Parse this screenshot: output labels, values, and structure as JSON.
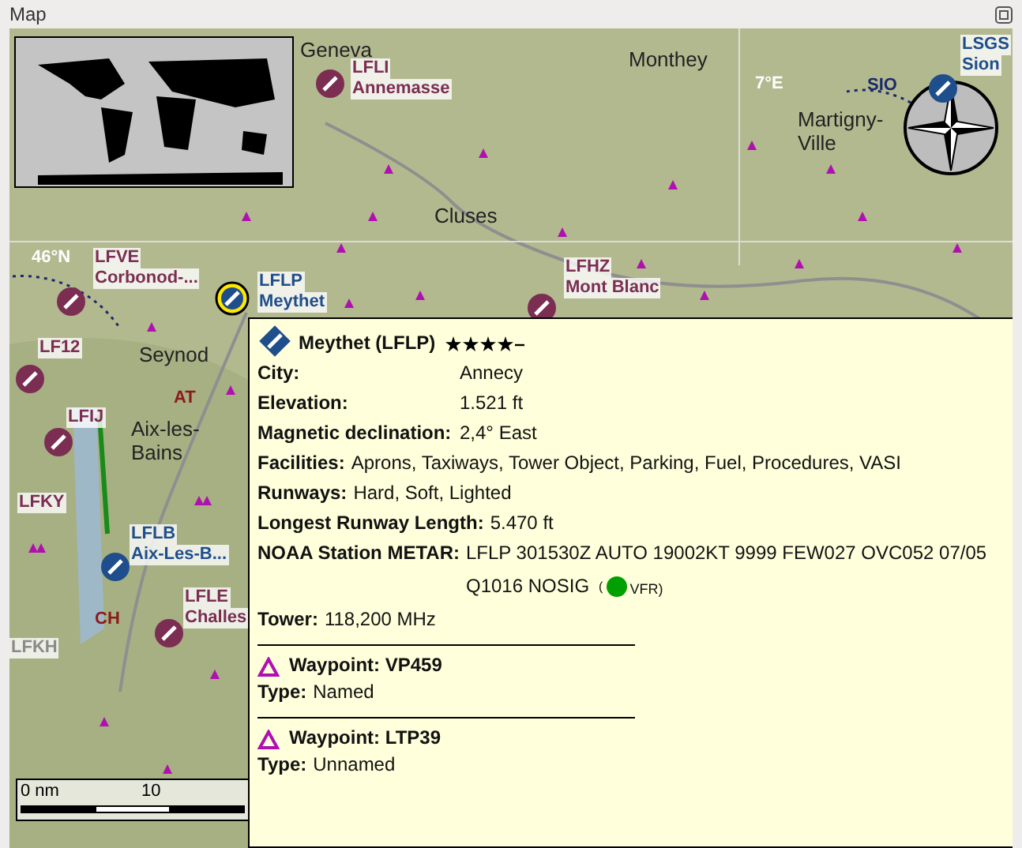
{
  "window": {
    "title": "Map"
  },
  "map": {
    "grid_labels": [
      {
        "text": "46°N"
      },
      {
        "text": "7°E"
      }
    ],
    "towns": [
      {
        "name": "Geneva"
      },
      {
        "name": "Monthey"
      },
      {
        "name": "Cluses"
      },
      {
        "name": "Martigny-Ville"
      },
      {
        "name": "Seynod"
      },
      {
        "name": "Aix-les-Bains"
      }
    ],
    "airports": [
      {
        "code": "LFLI",
        "name": "Annemasse",
        "color": "#7b2d52",
        "selected": false
      },
      {
        "code": "LFVE",
        "name": "Corbonod-...",
        "color": "#7b2d52",
        "selected": false
      },
      {
        "code": "LFLP",
        "name": "Meythet",
        "color": "#1f4e8c",
        "selected": true
      },
      {
        "code": "LFHZ",
        "name": "Mont Blanc",
        "color": "#7b2d52",
        "selected": false
      },
      {
        "code": "LSGS",
        "name": "Sion",
        "color": "#1f4e8c",
        "selected": false
      },
      {
        "code": "LF12",
        "color": "#7b2d52",
        "selected": false
      },
      {
        "code": "LFIJ",
        "color": "#7b2d52",
        "selected": false
      },
      {
        "code": "LFKY",
        "color": "#7b2d52",
        "selected": false
      },
      {
        "code": "LFLB",
        "name": "Aix-Les-B...",
        "color": "#1f4e8c",
        "selected": false
      },
      {
        "code": "LFLE",
        "name": "Challes",
        "color": "#7b2d52",
        "selected": false
      },
      {
        "code": "LFKH",
        "color": "#8a8a8a",
        "selected": false
      }
    ],
    "airspaces": [
      {
        "code": "AT",
        "color": "#8b1a1a"
      },
      {
        "code": "CH",
        "color": "#8b1a1a"
      },
      {
        "code": "SIO",
        "color": "#1a2a6b"
      }
    ],
    "scale": {
      "start": "0 nm",
      "mark": "10"
    }
  },
  "tooltip": {
    "title": "Meythet (LFLP)",
    "stars": 4,
    "rows": [
      {
        "kind": "column",
        "label": "City:",
        "value": "Annecy"
      },
      {
        "kind": "column",
        "label": "Elevation:",
        "value": "1.521 ft"
      },
      {
        "kind": "column",
        "label": "Magnetic declination:",
        "value": "2,4° East"
      },
      {
        "kind": "inline",
        "label": "Facilities:",
        "value": "Aprons, Taxiways, Tower Object, Parking, Fuel, Procedures, VASI"
      },
      {
        "kind": "inline",
        "label": "Runways:",
        "value": "Hard, Soft, Lighted"
      },
      {
        "kind": "inline",
        "label": "Longest Runway Length:",
        "value": "5.470 ft"
      }
    ],
    "metar": {
      "label": "NOAA Station METAR:",
      "lines": [
        "LFLP 301530Z AUTO 19002KT 9999 FEW027 OVC052 07/05",
        "Q1016 NOSIG"
      ],
      "open": "(",
      "category": "VFR)",
      "color": "#00a000"
    },
    "tower": {
      "label": "Tower:",
      "value": "118,200 MHz"
    },
    "waypoints": [
      {
        "title": "Waypoint: VP459",
        "type_label": "Type:",
        "type": "Named"
      },
      {
        "title": "Waypoint: LTP39",
        "type_label": "Type:",
        "type": "Unnamed"
      }
    ]
  }
}
